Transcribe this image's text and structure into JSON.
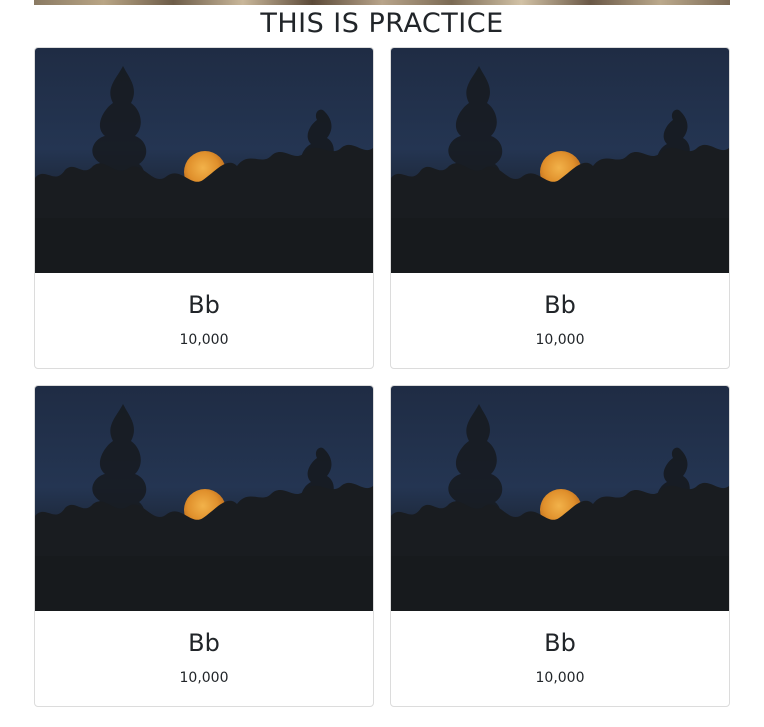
{
  "page": {
    "title": "THIS IS PRACTICE"
  },
  "products": [
    {
      "name": "Bb",
      "price": "10,000",
      "image": "moon-night-photo"
    },
    {
      "name": "Bb",
      "price": "10,000",
      "image": "moon-night-photo"
    },
    {
      "name": "Bb",
      "price": "10,000",
      "image": "moon-night-photo"
    },
    {
      "name": "Bb",
      "price": "10,000",
      "image": "moon-night-photo"
    }
  ]
}
